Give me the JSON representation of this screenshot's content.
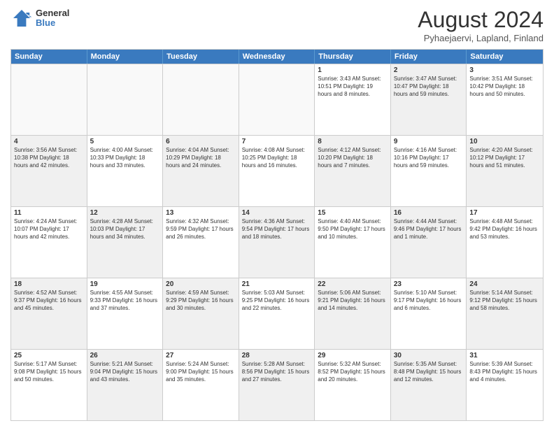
{
  "header": {
    "logo_line1": "General",
    "logo_line2": "Blue",
    "month_title": "August 2024",
    "location": "Pyhaejaervi, Lapland, Finland"
  },
  "weekdays": [
    "Sunday",
    "Monday",
    "Tuesday",
    "Wednesday",
    "Thursday",
    "Friday",
    "Saturday"
  ],
  "rows": [
    [
      {
        "num": "",
        "text": "",
        "empty": true
      },
      {
        "num": "",
        "text": "",
        "empty": true
      },
      {
        "num": "",
        "text": "",
        "empty": true
      },
      {
        "num": "",
        "text": "",
        "empty": true
      },
      {
        "num": "1",
        "text": "Sunrise: 3:43 AM\nSunset: 10:51 PM\nDaylight: 19 hours and 8 minutes.",
        "shaded": false
      },
      {
        "num": "2",
        "text": "Sunrise: 3:47 AM\nSunset: 10:47 PM\nDaylight: 18 hours and 59 minutes.",
        "shaded": true
      },
      {
        "num": "3",
        "text": "Sunrise: 3:51 AM\nSunset: 10:42 PM\nDaylight: 18 hours and 50 minutes.",
        "shaded": false
      }
    ],
    [
      {
        "num": "4",
        "text": "Sunrise: 3:56 AM\nSunset: 10:38 PM\nDaylight: 18 hours and 42 minutes.",
        "shaded": true
      },
      {
        "num": "5",
        "text": "Sunrise: 4:00 AM\nSunset: 10:33 PM\nDaylight: 18 hours and 33 minutes.",
        "shaded": false
      },
      {
        "num": "6",
        "text": "Sunrise: 4:04 AM\nSunset: 10:29 PM\nDaylight: 18 hours and 24 minutes.",
        "shaded": true
      },
      {
        "num": "7",
        "text": "Sunrise: 4:08 AM\nSunset: 10:25 PM\nDaylight: 18 hours and 16 minutes.",
        "shaded": false
      },
      {
        "num": "8",
        "text": "Sunrise: 4:12 AM\nSunset: 10:20 PM\nDaylight: 18 hours and 7 minutes.",
        "shaded": true
      },
      {
        "num": "9",
        "text": "Sunrise: 4:16 AM\nSunset: 10:16 PM\nDaylight: 17 hours and 59 minutes.",
        "shaded": false
      },
      {
        "num": "10",
        "text": "Sunrise: 4:20 AM\nSunset: 10:12 PM\nDaylight: 17 hours and 51 minutes.",
        "shaded": true
      }
    ],
    [
      {
        "num": "11",
        "text": "Sunrise: 4:24 AM\nSunset: 10:07 PM\nDaylight: 17 hours and 42 minutes.",
        "shaded": false
      },
      {
        "num": "12",
        "text": "Sunrise: 4:28 AM\nSunset: 10:03 PM\nDaylight: 17 hours and 34 minutes.",
        "shaded": true
      },
      {
        "num": "13",
        "text": "Sunrise: 4:32 AM\nSunset: 9:59 PM\nDaylight: 17 hours and 26 minutes.",
        "shaded": false
      },
      {
        "num": "14",
        "text": "Sunrise: 4:36 AM\nSunset: 9:54 PM\nDaylight: 17 hours and 18 minutes.",
        "shaded": true
      },
      {
        "num": "15",
        "text": "Sunrise: 4:40 AM\nSunset: 9:50 PM\nDaylight: 17 hours and 10 minutes.",
        "shaded": false
      },
      {
        "num": "16",
        "text": "Sunrise: 4:44 AM\nSunset: 9:46 PM\nDaylight: 17 hours and 1 minute.",
        "shaded": true
      },
      {
        "num": "17",
        "text": "Sunrise: 4:48 AM\nSunset: 9:42 PM\nDaylight: 16 hours and 53 minutes.",
        "shaded": false
      }
    ],
    [
      {
        "num": "18",
        "text": "Sunrise: 4:52 AM\nSunset: 9:37 PM\nDaylight: 16 hours and 45 minutes.",
        "shaded": true
      },
      {
        "num": "19",
        "text": "Sunrise: 4:55 AM\nSunset: 9:33 PM\nDaylight: 16 hours and 37 minutes.",
        "shaded": false
      },
      {
        "num": "20",
        "text": "Sunrise: 4:59 AM\nSunset: 9:29 PM\nDaylight: 16 hours and 30 minutes.",
        "shaded": true
      },
      {
        "num": "21",
        "text": "Sunrise: 5:03 AM\nSunset: 9:25 PM\nDaylight: 16 hours and 22 minutes.",
        "shaded": false
      },
      {
        "num": "22",
        "text": "Sunrise: 5:06 AM\nSunset: 9:21 PM\nDaylight: 16 hours and 14 minutes.",
        "shaded": true
      },
      {
        "num": "23",
        "text": "Sunrise: 5:10 AM\nSunset: 9:17 PM\nDaylight: 16 hours and 6 minutes.",
        "shaded": false
      },
      {
        "num": "24",
        "text": "Sunrise: 5:14 AM\nSunset: 9:12 PM\nDaylight: 15 hours and 58 minutes.",
        "shaded": true
      }
    ],
    [
      {
        "num": "25",
        "text": "Sunrise: 5:17 AM\nSunset: 9:08 PM\nDaylight: 15 hours and 50 minutes.",
        "shaded": false
      },
      {
        "num": "26",
        "text": "Sunrise: 5:21 AM\nSunset: 9:04 PM\nDaylight: 15 hours and 43 minutes.",
        "shaded": true
      },
      {
        "num": "27",
        "text": "Sunrise: 5:24 AM\nSunset: 9:00 PM\nDaylight: 15 hours and 35 minutes.",
        "shaded": false
      },
      {
        "num": "28",
        "text": "Sunrise: 5:28 AM\nSunset: 8:56 PM\nDaylight: 15 hours and 27 minutes.",
        "shaded": true
      },
      {
        "num": "29",
        "text": "Sunrise: 5:32 AM\nSunset: 8:52 PM\nDaylight: 15 hours and 20 minutes.",
        "shaded": false
      },
      {
        "num": "30",
        "text": "Sunrise: 5:35 AM\nSunset: 8:48 PM\nDaylight: 15 hours and 12 minutes.",
        "shaded": true
      },
      {
        "num": "31",
        "text": "Sunrise: 5:39 AM\nSunset: 8:43 PM\nDaylight: 15 hours and 4 minutes.",
        "shaded": false
      }
    ]
  ]
}
